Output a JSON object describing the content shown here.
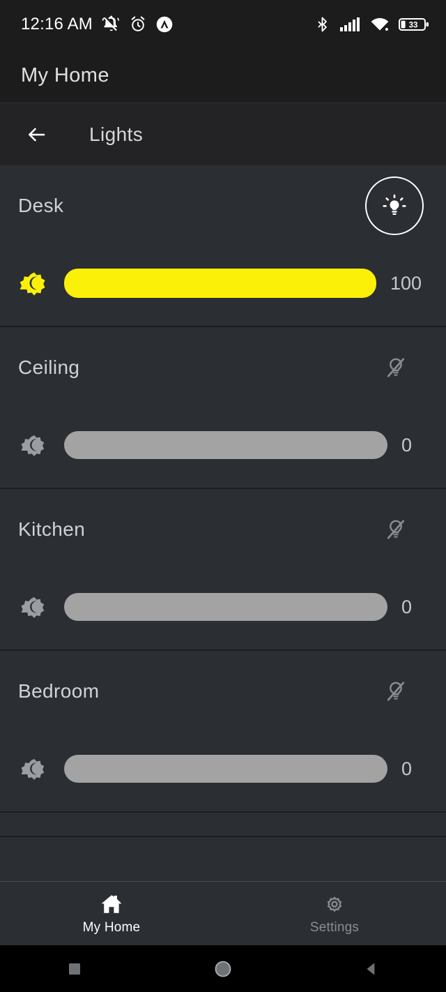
{
  "status_bar": {
    "time": "12:16 AM",
    "left_icons": [
      "bell-muted-icon",
      "alarm-clock-icon",
      "app-badge-a-icon"
    ],
    "right_icons": [
      "bluetooth-icon",
      "cellular-signal-icon",
      "wifi-icon"
    ],
    "battery_level": "33"
  },
  "app_bar": {
    "title": "My Home"
  },
  "sub_header": {
    "back_icon": "back-arrow-icon",
    "title": "Lights"
  },
  "lights": [
    {
      "name": "Desk",
      "state": "on",
      "power_icon": "lightbulb-on-icon",
      "brightness_icon": "brightness-icon",
      "value": "100",
      "percent": 100
    },
    {
      "name": "Ceiling",
      "state": "off",
      "power_icon": "lightbulb-off-icon",
      "brightness_icon": "brightness-icon",
      "value": "0",
      "percent": 0
    },
    {
      "name": "Kitchen",
      "state": "off",
      "power_icon": "lightbulb-off-icon",
      "brightness_icon": "brightness-icon",
      "value": "0",
      "percent": 0
    },
    {
      "name": "Bedroom",
      "state": "off",
      "power_icon": "lightbulb-off-icon",
      "brightness_icon": "brightness-icon",
      "value": "0",
      "percent": 0
    }
  ],
  "tab_bar": {
    "tabs": [
      {
        "label": "My Home",
        "icon": "home-icon",
        "active": true
      },
      {
        "label": "Settings",
        "icon": "gear-icon",
        "active": false
      }
    ]
  },
  "nav_bar": {
    "buttons": [
      "recents-square-icon",
      "home-circle-icon",
      "back-triangle-icon"
    ]
  },
  "colors": {
    "accent_yellow": "#fbf007",
    "row_background": "#2b2e33",
    "bar_background": "#1c1c1c",
    "inactive_grey": "#8a8d91",
    "track_grey": "#a3a3a3"
  }
}
